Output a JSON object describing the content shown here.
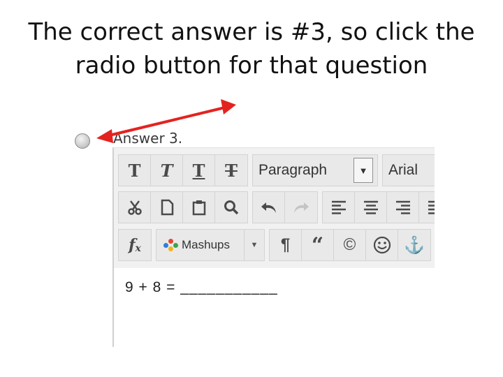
{
  "slide": {
    "title": "The correct answer is #3, so click the\nradio button for that question"
  },
  "answer": {
    "label": "Answer 3."
  },
  "annotation": {
    "arrow_color": "#e3231f"
  },
  "toolbar": {
    "row1": {
      "format_buttons": [
        {
          "name": "bold-icon",
          "glyph": "T"
        },
        {
          "name": "italic-icon",
          "glyph": "T"
        },
        {
          "name": "underline-icon",
          "glyph": "T"
        },
        {
          "name": "strikethrough-icon",
          "glyph": "T"
        }
      ],
      "paragraph_label": "Paragraph",
      "font_label": "Arial"
    },
    "row2": {
      "edit_icons": [
        "cut-icon",
        "new-page-icon",
        "paste-icon",
        "search-icon"
      ],
      "undo_icons": [
        "undo-icon",
        "redo-icon"
      ],
      "align_icons": [
        "align-left-icon",
        "align-center-icon",
        "align-right-icon",
        "justify-icon"
      ]
    },
    "row3": {
      "formula_icon": "fx-icon",
      "mashups_label": "Mashups",
      "misc_icons": [
        "paragraph-mark-icon",
        "blockquote-icon",
        "copyright-icon",
        "smiley-icon",
        "anchor-icon"
      ]
    }
  },
  "editor": {
    "content": "9 + 8 = ___________"
  }
}
